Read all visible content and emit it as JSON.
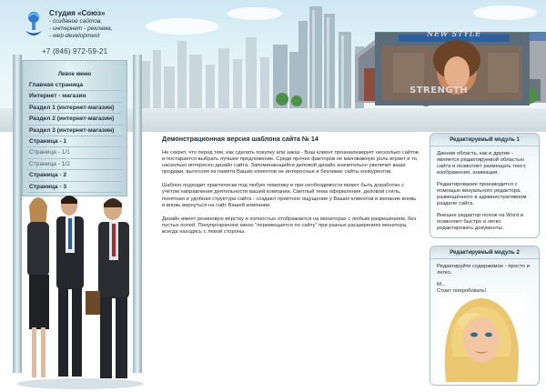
{
  "logo": {
    "icon": "studio-logo-icon",
    "title": "Студия «Союз»",
    "lines": [
      "- создание сайтов,",
      "- интернет - реклама,",
      "- web-development"
    ]
  },
  "header": {
    "phone": "+7 (846) 972-59-21",
    "billboard_title": "NEW STYLE",
    "billboard_word": "STRENGTH"
  },
  "menu": {
    "heading": "Левое меню",
    "items": [
      {
        "label": "Главная страница",
        "sub": false
      },
      {
        "label": "Интернет - магазин",
        "sub": false
      },
      {
        "label": "Раздел 1 (интернет-магазин)",
        "sub": false
      },
      {
        "label": "Раздел 2 (интернет-магазин)",
        "sub": false
      },
      {
        "label": "Раздел 3 (интернет-магазин)",
        "sub": false
      },
      {
        "label": "Страница - 1",
        "sub": false
      },
      {
        "label": "Страница - 1/1",
        "sub": true
      },
      {
        "label": "Страница - 1/2",
        "sub": true
      },
      {
        "label": "Страница - 2",
        "sub": false
      },
      {
        "label": "Страница - 3",
        "sub": false
      }
    ]
  },
  "main": {
    "title": "Демонстрационная версия шаблона сайта № 14",
    "paragraphs": [
      "Не секрет, что перед тем, как сделать покупку или заказ - Ваш клиент проанализирует несколько сайтов и постарается выбрать лучшее предложение. Среди прочих факторов не маловажную роль играет и то, насколько интересен дизайн сайта. Запоминающийся деловой дизайн значительно увеличит ваши продажи, вытесняя из памяти Ваших клиентов не интересные и безликие сайты конкурентов.",
      "Шаблон подходит практически под любую тематику и при необходимости может быть доработан с учётом направления деятельности вашей компании. Светлый тема оформления, деловой стиль, понятная и удобная структура сайта - создают приятное ощущение у Ваших клиентов и желание вновь и вновь вернуться на сайт Вашей компании.",
      "Дизайн имеет резиновую вёрстку и полностью отображается на мониторах с любым разрешением, без пустых полей. Полупрозрачное меню \"перемещается по сайту\" при разных расширениях монитора, всегда находясь с левой стороны."
    ]
  },
  "module1": {
    "title": "Редактируемый модуль 1",
    "paragraphs": [
      "Данная область, как и другие - является редактируемой областью сайта и позволяет размещать текст, изображения, анимации.",
      "Редактирование производится с помощью визуального редактора, размещённого в административном разделе сайта.",
      "Внешне редактор похож на Word и позволяет быстро и легко редактировать документы."
    ]
  },
  "module2": {
    "title": "Редактируемый модуль 2",
    "paragraphs": [
      "Редактируйте содержимое - просто и легко.",
      "М...",
      "Стоит попробовать!"
    ]
  },
  "colors": {
    "panel": "#d6e6ec",
    "border": "#a9c0c9",
    "text": "#222222"
  }
}
